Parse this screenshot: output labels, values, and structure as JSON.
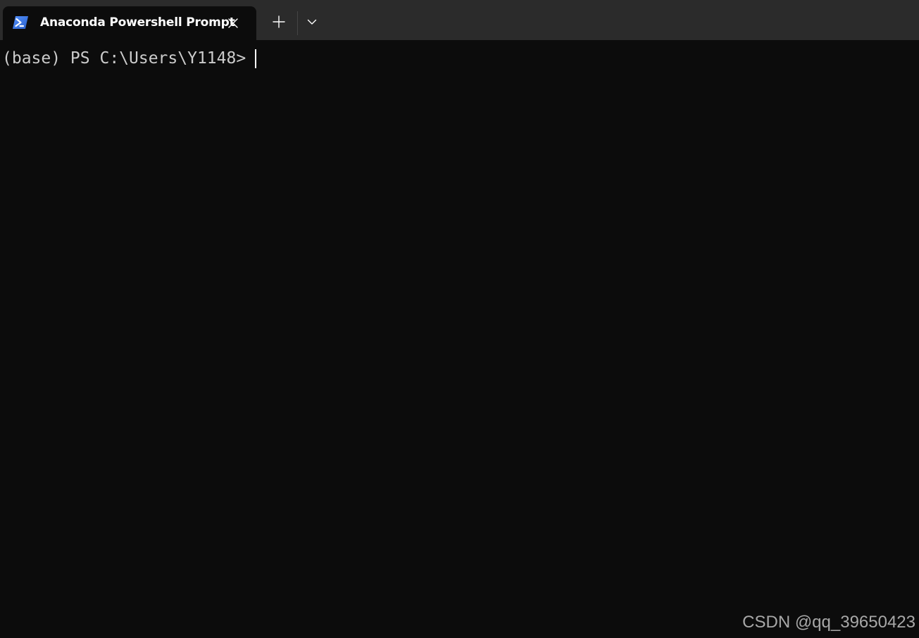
{
  "window": {
    "background": "#0c0c0c",
    "titlebar_color": "#2b2b2b"
  },
  "tab": {
    "title": "Anaconda Powershell Prompt",
    "icon": "powershell-icon",
    "close_icon": "close-icon"
  },
  "toolbar": {
    "new_tab_icon": "plus-icon",
    "dropdown_icon": "chevron-down-icon"
  },
  "terminal": {
    "prompt": "(base) PS C:\\Users\\Y1148>",
    "text_color": "#cccccc"
  },
  "watermark": {
    "text": "CSDN @qq_39650423"
  }
}
